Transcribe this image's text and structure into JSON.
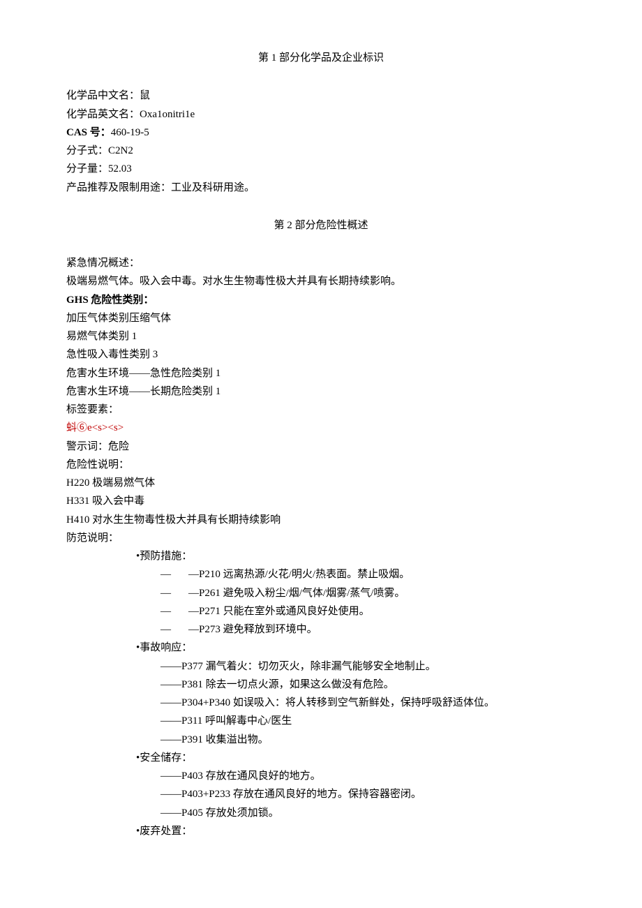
{
  "section1": {
    "title": "第 1 部分化学品及企业标识",
    "chineseName": {
      "label": "化学品中文名：",
      "value": "鼠"
    },
    "englishName": {
      "label": "化学品英文名：",
      "value": "Oxa1onitri1e"
    },
    "cas": {
      "label": "CAS 号：",
      "value": "460-19-5"
    },
    "formula": {
      "label": "分子式：",
      "value": "C2N2"
    },
    "mw": {
      "label": "分子量：",
      "value": "52.03"
    },
    "use": {
      "label": "产品推荐及限制用途：",
      "value": "工业及科研用途。"
    }
  },
  "section2": {
    "title": "第 2 部分危险性概述",
    "emergency": {
      "label": "紧急情况概述：",
      "text": "极端易燃气体。吸入会中毒。对水生生物毒性极大并具有长期持续影响。"
    },
    "ghs": {
      "label": "GHS 危险性类别：",
      "items": [
        "加压气体类别压缩气体",
        "易燃气体类别 1",
        "急性吸入毒性类别 3",
        "危害水生环境——急性危险类别 1",
        "危害水生环境——长期危险类别 1"
      ]
    },
    "labelElements": "标签要素：",
    "pictogramText": "蚪⑥e<s><s>",
    "signal": {
      "label": "警示词：",
      "value": "危险"
    },
    "hazardLabel": "危险性说明：",
    "hazardStatements": [
      "H220 极端易燃气体",
      "H331 吸入会中毒",
      "H410 对水生生物毒性极大并具有长期持续影响"
    ],
    "precautionLabel": "防范说明：",
    "prevention": {
      "label": "预防措施：",
      "items": [
        "P210 远离热源/火花/明火/热表面。禁止吸烟。",
        "P261 避免吸入粉尘/烟/气体/烟雾/蒸气/喷雾。",
        "P271 只能在室外或通风良好处使用。",
        "P273 避免释放到环境中。"
      ]
    },
    "response": {
      "label": "事故响应：",
      "items": [
        "P377 漏气着火：切勿灭火，除非漏气能够安全地制止。",
        "P381 除去一切点火源，如果这么做没有危险。",
        "P304+P340 如误吸入：将人转移到空气新鲜处，保持呼吸舒适体位。",
        "P311 呼叫解毒中心/医生",
        "P391 收集溢出物。"
      ]
    },
    "storage": {
      "label": "安全储存：",
      "items": [
        "P403 存放在通风良好的地方。",
        "P403+P233 存放在通风良好的地方。保持容器密闭。",
        "P405 存放处须加锁。"
      ]
    },
    "disposal": {
      "label": "废弃处置："
    }
  }
}
